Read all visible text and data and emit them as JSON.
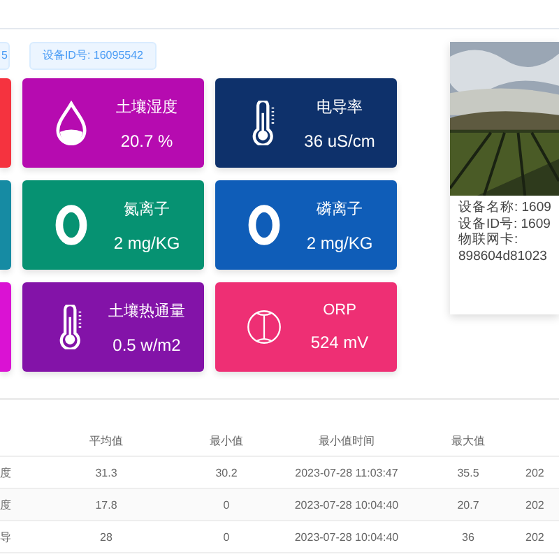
{
  "tags": [
    {
      "text": "5"
    },
    {
      "text": "设备ID号: 16095542"
    }
  ],
  "cards": [
    {
      "kind": "partial",
      "color": "#f5333f"
    },
    {
      "kind": "drop",
      "color": "#b60bb0",
      "label": "土壤湿度",
      "value": "20.7 %"
    },
    {
      "kind": "thermometer",
      "color": "#0e316b",
      "label": "电导率",
      "value": "36 uS/cm"
    },
    {
      "kind": "partial",
      "color": "#168ba3"
    },
    {
      "kind": "ring",
      "color": "#069272",
      "label": "氮离子",
      "value": "2 mg/KG"
    },
    {
      "kind": "ring",
      "color": "#0f5db8",
      "label": "磷离子",
      "value": "2 mg/KG"
    },
    {
      "kind": "partial",
      "color": "#da12d3"
    },
    {
      "kind": "thermometer",
      "color": "#8313a8",
      "label": "土壤热通量",
      "value": "0.5 w/m2"
    },
    {
      "kind": "globe",
      "color": "#ee2f74",
      "label": "ORP",
      "value": "524 mV"
    }
  ],
  "device": {
    "lines": [
      "设备名称: 1609",
      "设备ID号: 1609",
      "物联网卡:",
      "898604d81023"
    ]
  },
  "table": {
    "columns": [
      "",
      "平均值",
      "最小值",
      "最小值时间",
      "最大值"
    ],
    "rows": [
      {
        "cells": [
          "度",
          "31.3",
          "30.2",
          "2023-07-28 11:03:47",
          "35.5",
          "202"
        ]
      },
      {
        "cells": [
          "度",
          "17.8",
          "0",
          "2023-07-28 10:04:40",
          "20.7",
          "202"
        ]
      },
      {
        "cells": [
          "导",
          "28",
          "0",
          "2023-07-28 10:04:40",
          "36",
          "202"
        ]
      }
    ]
  }
}
